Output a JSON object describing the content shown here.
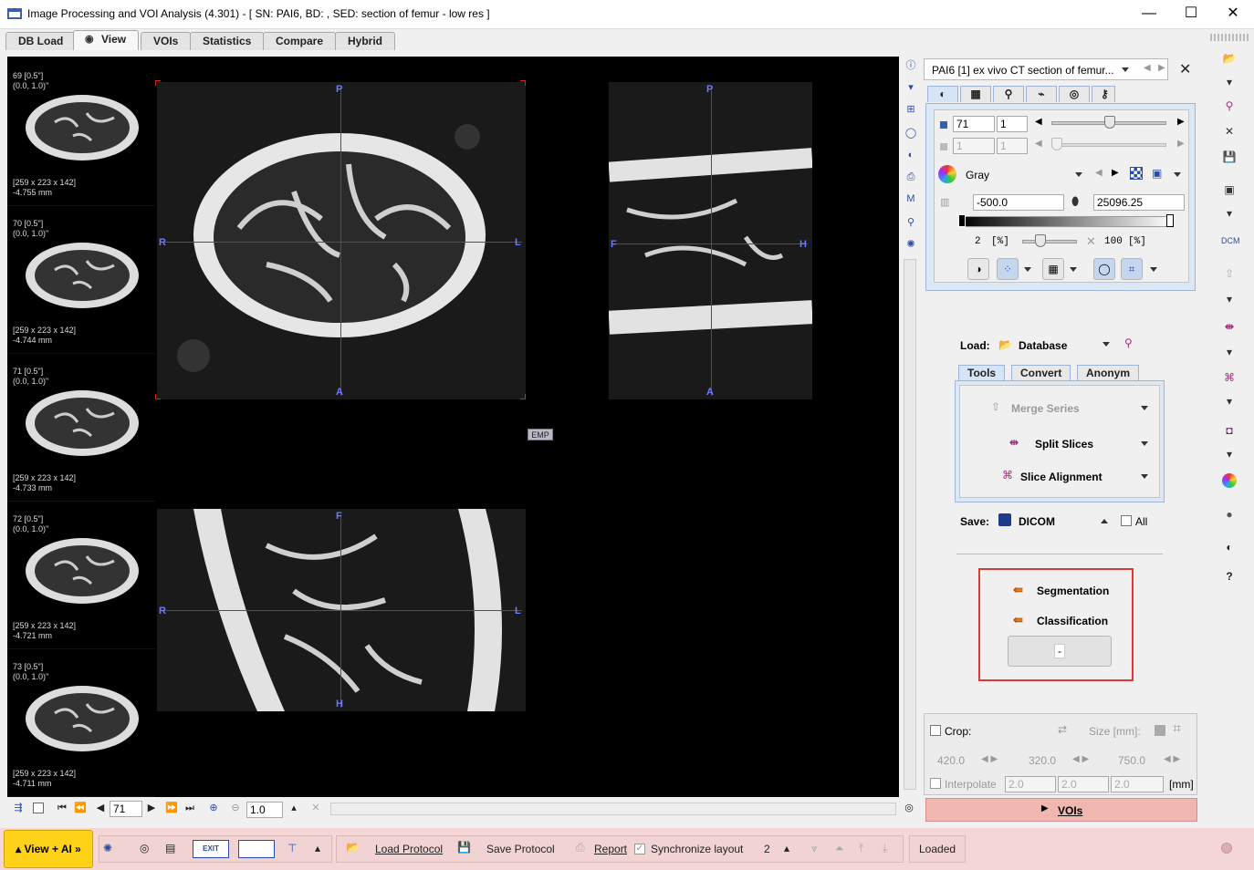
{
  "window": {
    "title": "Image Processing and VOI Analysis (4.301) - [ SN: PAI6, BD: , SED: section of femur - low res ]",
    "minimize": "—",
    "maximize": "☐",
    "close": "✕"
  },
  "tabs": [
    {
      "label": "DB Load"
    },
    {
      "label": "View"
    },
    {
      "label": "VOIs"
    },
    {
      "label": "Statistics"
    },
    {
      "label": "Compare"
    },
    {
      "label": "Hybrid"
    }
  ],
  "thumbnails": [
    {
      "top": "69 [0.5\"]\n(0.0, 1.0)\"",
      "bottom": "[259 x 223 x 142]\n-4.755 mm"
    },
    {
      "top": "70 [0.5\"]\n(0.0, 1.0)\"",
      "bottom": "[259 x 223 x 142]\n-4.744 mm"
    },
    {
      "top": "71 [0.5\"]\n(0.0, 1.0)\"",
      "bottom": "[259 x 223 x 142]\n-4.733 mm"
    },
    {
      "top": "72 [0.5\"]\n(0.0, 1.0)\"",
      "bottom": "[259 x 223 x 142]\n-4.721 mm"
    },
    {
      "top": "73 [0.5\"]\n(0.0, 1.0)\"",
      "bottom": "[259 x 223 x 142]\n-4.711 mm"
    }
  ],
  "orientation": {
    "axial": {
      "top": "P",
      "bottom": "A",
      "left": "R",
      "right": "L"
    },
    "sagittal": {
      "top": "P",
      "bottom": "A",
      "left": "F",
      "right": "H"
    },
    "coronal": {
      "top": "F",
      "bottom": "H",
      "left": "R",
      "right": "L"
    },
    "emp": "EMP"
  },
  "nav": {
    "slice": "71",
    "zoom": "1.0"
  },
  "series": {
    "name": "PAI6 [1] ex vivo CT section of femur..."
  },
  "controls": {
    "slice_a": "71",
    "slice_b": "1",
    "frame_a": "1",
    "frame_b": "1",
    "colormap": "Gray",
    "min": "-500.0",
    "max": "25096.25",
    "lower_pct": "2",
    "upper_pct": "100",
    "pct_unit": "[%]",
    "lower_fraction": 0.33,
    "upper_fraction": 0.0
  },
  "load": {
    "label": "Load:",
    "source": "Database"
  },
  "tool_tabs": [
    {
      "label": "Tools"
    },
    {
      "label": "Convert"
    },
    {
      "label": "Anonym"
    }
  ],
  "tools": {
    "merge": "Merge Series",
    "split": "Split Slices",
    "align": "Slice Alignment"
  },
  "save": {
    "label": "Save:",
    "format": "DICOM",
    "all_label": "All"
  },
  "ai": {
    "segmentation": "Segmentation",
    "classification": "Classification",
    "dash": "-"
  },
  "crop": {
    "label": "Crop:",
    "size_label": "Size [mm]:",
    "x": "420.0",
    "y": "320.0",
    "z": "750.0",
    "interpolate": "Interpolate",
    "ix": "2.0",
    "iy": "2.0",
    "iz": "2.0",
    "unit": "[mm]"
  },
  "vois_button": "VOIs",
  "bottom": {
    "view_ai": "View + AI »",
    "load_protocol": "Load Protocol",
    "save_protocol": "Save Protocol",
    "report": "Report",
    "sync": "Synchronize layout",
    "layout_num": "2",
    "status": "Loaded"
  }
}
